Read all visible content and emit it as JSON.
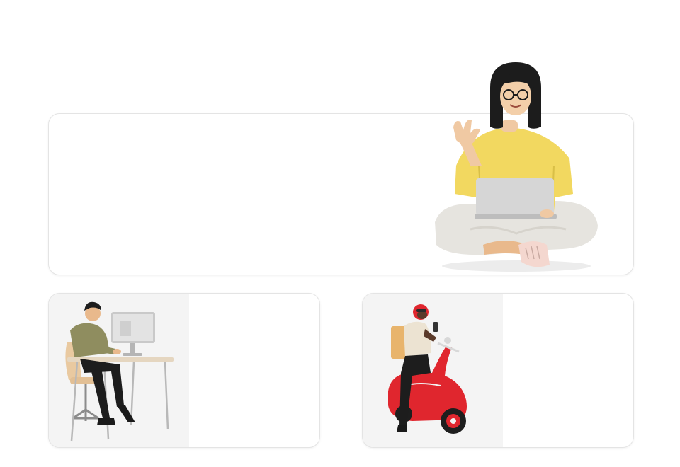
{
  "hero": {
    "illustration": "woman-sitting-with-laptop-waving-icon"
  },
  "cards": [
    {
      "illustration": "man-at-computer-desk-icon"
    },
    {
      "illustration": "courier-on-red-scooter-icon"
    }
  ],
  "colors": {
    "card_border": "#e4e4e4",
    "thumb_background": "#f4f4f4",
    "shirt_yellow": "#f2d860",
    "scooter_red": "#e0262e"
  }
}
